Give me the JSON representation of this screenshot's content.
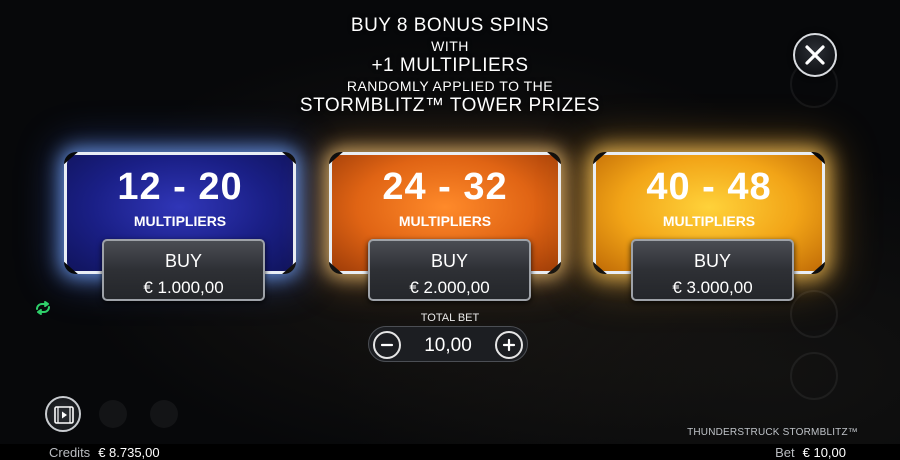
{
  "header": {
    "line1": "BUY 8 BONUS SPINS",
    "line2": "WITH",
    "line3": "+1 MULTIPLIERS",
    "line4": "RANDOMLY APPLIED TO THE",
    "line5": "STORMBLITZ™ TOWER PRIZES"
  },
  "options": [
    {
      "range": "12 - 20",
      "label": "MULTIPLIERS",
      "buy_label": "BUY",
      "price": "€ 1.000,00",
      "color": "#1a1f86"
    },
    {
      "range": "24 - 32",
      "label": "MULTIPLIERS",
      "buy_label": "BUY",
      "price": "€ 2.000,00",
      "color": "#e06414"
    },
    {
      "range": "40 - 48",
      "label": "MULTIPLIERS",
      "buy_label": "BUY",
      "price": "€ 3.000,00",
      "color": "#f2a417"
    }
  ],
  "bet": {
    "label": "TOTAL BET",
    "value": "10,00"
  },
  "game_title": "THUNDERSTRUCK STORMBLITZ™",
  "footer": {
    "credits_label": "Credits",
    "credits_value": "€ 8.735,00",
    "bet_label": "Bet",
    "bet_value": "€ 10,00"
  },
  "icons": {
    "close": "close-icon",
    "minus": "minus-icon",
    "plus": "plus-icon",
    "autoplay": "loop-icon",
    "video": "video-icon"
  },
  "colors": {
    "accent_green": "#2fd06a",
    "button_border": "#9ea2a8"
  }
}
